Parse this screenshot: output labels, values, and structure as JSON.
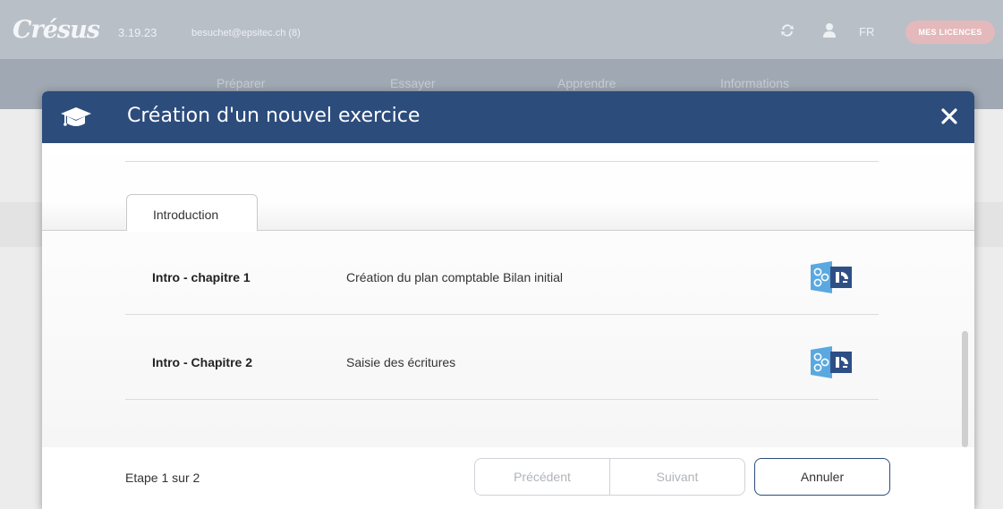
{
  "app": {
    "logo": "Crésus",
    "version": "3.19.23",
    "user_email": "besuchet@epsitec.ch (8)",
    "language": "FR",
    "licences_label": "MES LICENCES",
    "nav": [
      "Préparer",
      "Essayer",
      "Apprendre",
      "Informations"
    ]
  },
  "modal": {
    "title": "Création d'un nouvel exercice",
    "tab_label": "Introduction",
    "rows": [
      {
        "title": "Intro - chapitre 1",
        "description": "Création du plan comptable Bilan initial",
        "icon": "cresus-comptabilite-icon"
      },
      {
        "title": "Intro - Chapitre 2",
        "description": "Saisie des écritures",
        "icon": "cresus-comptabilite-icon"
      }
    ],
    "footer": {
      "step_label": "Etape 1 sur 2",
      "previous_label": "Précédent",
      "next_label": "Suivant",
      "cancel_label": "Annuler"
    }
  },
  "colors": {
    "header_blue": "#2c4c7c",
    "licences_pink": "#e4b9bc",
    "icon_light_blue": "#5aa8e0",
    "icon_dark_blue": "#2e4f86"
  }
}
